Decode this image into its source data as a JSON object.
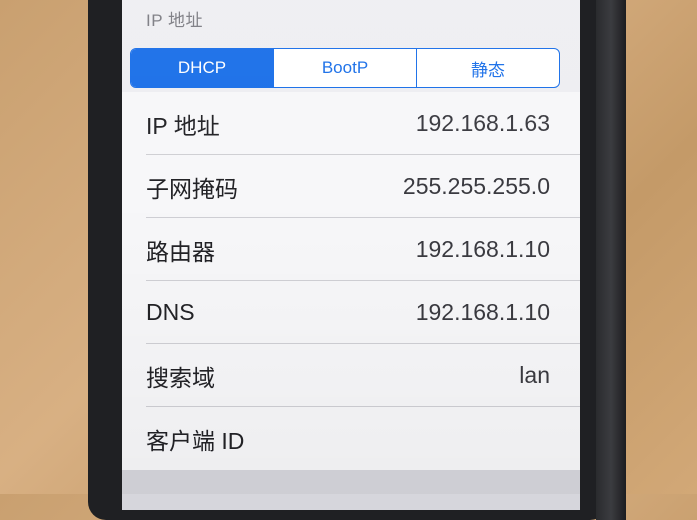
{
  "section_header": "IP 地址",
  "segments": [
    {
      "label": "DHCP",
      "active": true
    },
    {
      "label": "BootP",
      "active": false
    },
    {
      "label": "静态",
      "active": false
    }
  ],
  "rows": [
    {
      "label": "IP 地址",
      "value": "192.168.1.63"
    },
    {
      "label": "子网掩码",
      "value": "255.255.255.0"
    },
    {
      "label": "路由器",
      "value": "192.168.1.10"
    },
    {
      "label": "DNS",
      "value": "192.168.1.10"
    },
    {
      "label": "搜索域",
      "value": "lan"
    },
    {
      "label": "客户端 ID",
      "value": ""
    }
  ],
  "colors": {
    "accent": "#1a6fe8",
    "background": "#eeeef2",
    "cell": "#f7f7f9"
  }
}
